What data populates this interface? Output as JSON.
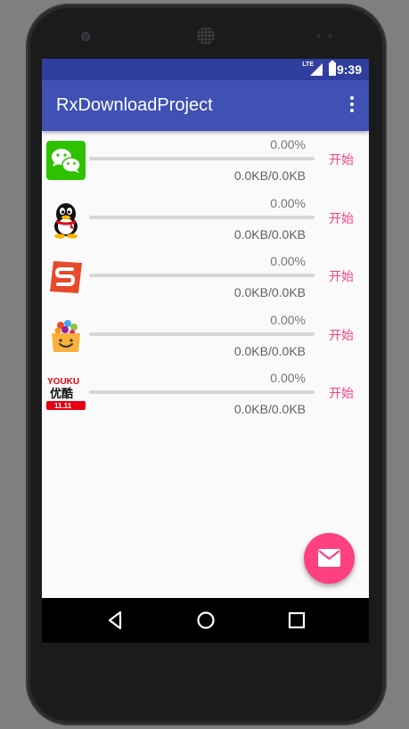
{
  "status_bar": {
    "time": "9:39",
    "network": "LTE"
  },
  "app_bar": {
    "title": "RxDownloadProject",
    "menu_icon": "more-vert-icon"
  },
  "colors": {
    "primary": "#3f51b5",
    "primary_dark": "#303f9f",
    "accent": "#ff4081"
  },
  "downloads": [
    {
      "app": "wechat",
      "icon": "wechat-icon",
      "percent": "0.00%",
      "size": "0.0KB/0.0KB",
      "progress": 0,
      "action": "开始"
    },
    {
      "app": "qq",
      "icon": "qq-penguin-icon",
      "percent": "0.00%",
      "size": "0.0KB/0.0KB",
      "progress": 0,
      "action": "开始"
    },
    {
      "app": "sogou",
      "icon": "sogou-icon",
      "percent": "0.00%",
      "size": "0.0KB/0.0KB",
      "progress": 0,
      "action": "开始"
    },
    {
      "app": "app-store",
      "icon": "shopping-bag-icon",
      "percent": "0.00%",
      "size": "0.0KB/0.0KB",
      "progress": 0,
      "action": "开始"
    },
    {
      "app": "youku",
      "icon": "youku-logo-icon",
      "logo_text_top": "YOUKU",
      "logo_text_main": "优酷",
      "logo_text_badge": "11.11",
      "percent": "0.00%",
      "size": "0.0KB/0.0KB",
      "progress": 0,
      "action": "开始"
    }
  ],
  "fab": {
    "icon": "mail-icon"
  },
  "nav_bar": {
    "back": "back-icon",
    "home": "home-icon",
    "recents": "recents-icon"
  }
}
